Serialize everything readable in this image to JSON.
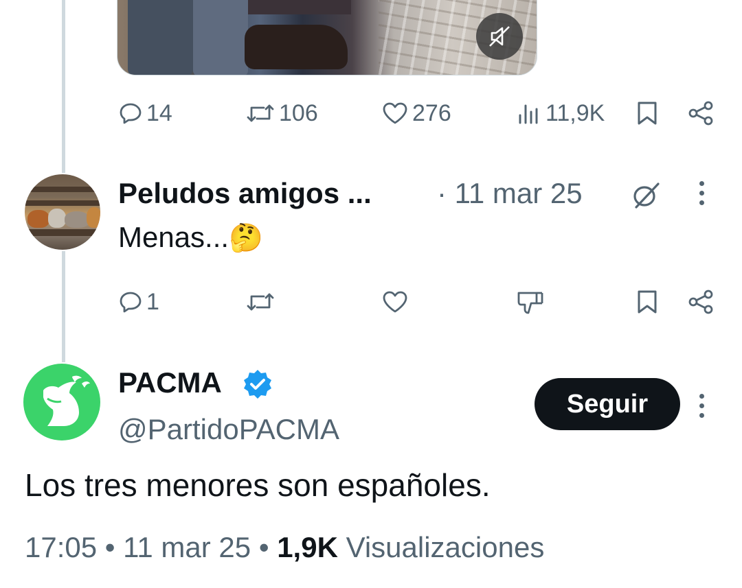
{
  "prev_tweet": {
    "media_mute_icon": "speaker-muted-icon",
    "actions": {
      "replies": "14",
      "retweets": "106",
      "likes": "276",
      "views": "11,9K"
    }
  },
  "reply": {
    "display_name": "Peludos amigos ...",
    "date": "· 11 mar 25",
    "text": "Menas...",
    "emoji": "🤔",
    "badge_icon": "grok-slash-icon",
    "actions": {
      "replies": "1"
    }
  },
  "main_tweet": {
    "display_name": "PACMA",
    "handle": "@PartidoPACMA",
    "follow_label": "Seguir",
    "text": "Los tres menores son españoles.",
    "time": "17:05",
    "sep1": " • ",
    "date": "11 mar 25",
    "sep2": " • ",
    "views_count": "1,9K",
    "views_label": " Visualizaciones",
    "colors": {
      "avatar_green": "#3bd36a",
      "verified_blue": "#1d9bf0"
    }
  }
}
